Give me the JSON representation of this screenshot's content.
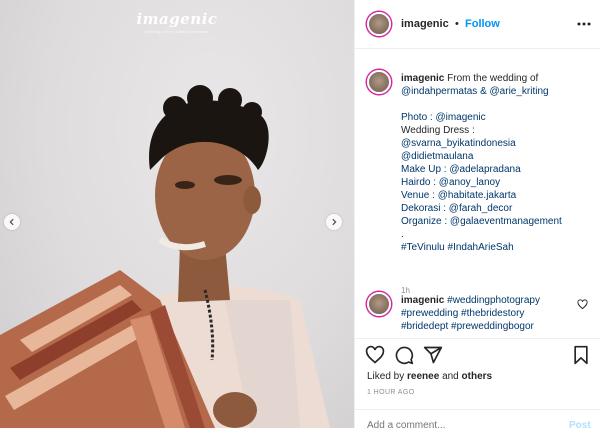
{
  "photo": {
    "watermark_title": "imagenic",
    "watermark_tagline": "visiting story without wonder"
  },
  "header": {
    "username": "imagenic",
    "dot": "•",
    "follow_label": "Follow"
  },
  "caption": {
    "username": "imagenic",
    "lines": [
      "From the wedding of",
      "@indahpermatas & @arie_kriting",
      "",
      "Photo : @imagenic",
      "Wedding Dress :",
      "@svarna_byikatindonesia",
      "@didietmaulana",
      "Make Up : @adelapradana",
      "Hairdo : @anoy_lanoy",
      "Venue : @habitate.jakarta",
      "Dekorasi : @farah_decor",
      "Organize : @galaeventmanagement",
      ".",
      "#TeVinulu #IndahArieSah"
    ],
    "time": "1h"
  },
  "comment": {
    "username": "imagenic",
    "text": "#weddingphotograpy #prewedding #thebridestory #bridedept #preweddingbogor"
  },
  "likes": {
    "prefix": "Liked by",
    "user": "reenee",
    "and": "and",
    "others": "others"
  },
  "post_time": "1 HOUR AGO",
  "add_comment": {
    "placeholder": "Add a comment...",
    "post_label": "Post"
  },
  "icons": {
    "more": "more-icon",
    "like": "heart-icon",
    "comment": "comment-icon",
    "share": "share-icon",
    "save": "bookmark-icon",
    "prev": "chevron-left-icon",
    "next": "chevron-right-icon"
  },
  "colors": {
    "accent": "#0095f6",
    "link": "#00376b",
    "muted": "#8e8e8e",
    "post_disabled": "#b2dffc"
  }
}
